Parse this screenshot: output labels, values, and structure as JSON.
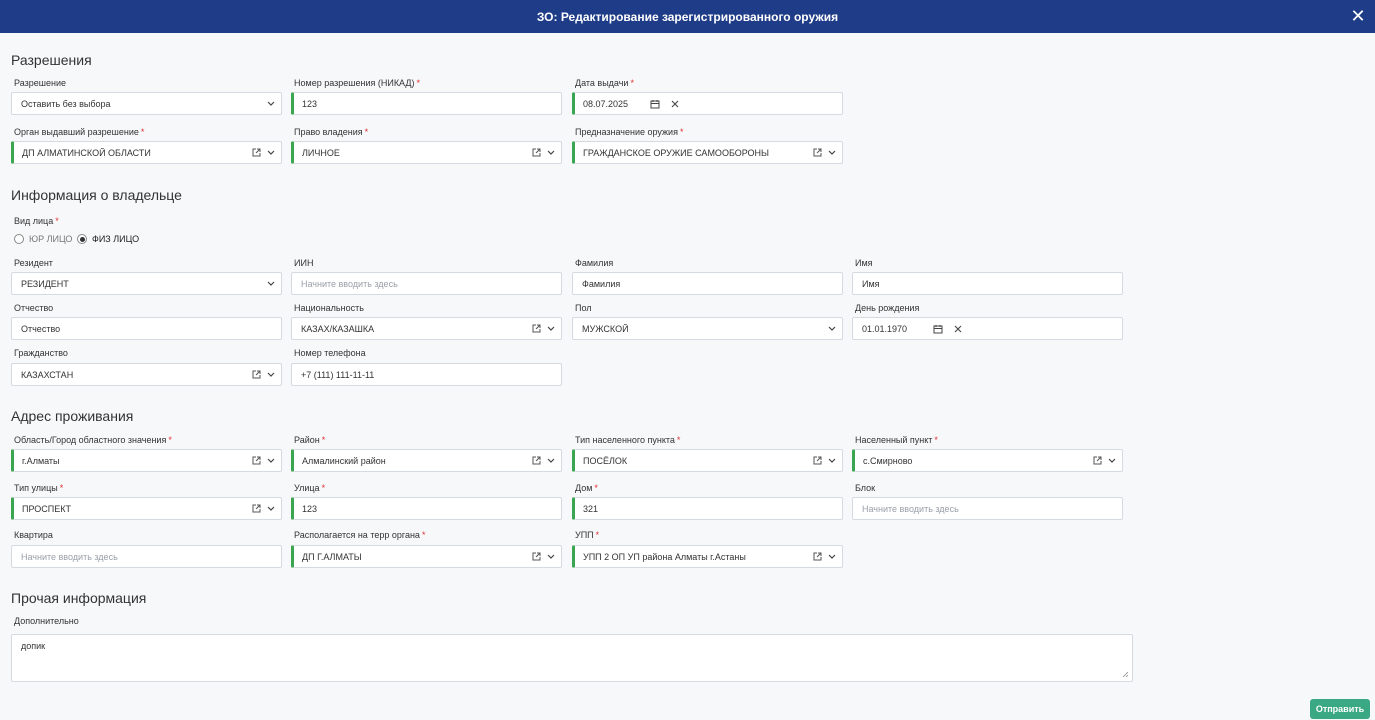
{
  "window": {
    "title": "ЗО: Редактирование зарегистрированного оружия",
    "close_label": "✕"
  },
  "permits": {
    "title": "Разрешения",
    "permit": {
      "label": "Разрешение",
      "value": "Оставить без выбора"
    },
    "permit_number": {
      "label": "Номер разрешения (НИКАД)",
      "value": "123"
    },
    "issue_date": {
      "label": "Дата выдачи",
      "value": "08.07.2025"
    },
    "issuing_body": {
      "label": "Орган выдавший разрешение",
      "value": "ДП АЛМАТИНСКОЙ ОБЛАСТИ"
    },
    "ownership_right": {
      "label": "Право владения",
      "value": "ЛИЧНОЕ"
    },
    "weapon_purpose": {
      "label": "Предназначение оружия",
      "value": "ГРАЖДАНСКОЕ ОРУЖИЕ САМООБОРОНЫ"
    }
  },
  "owner": {
    "title": "Информация о владельце",
    "person_type": {
      "label": "Вид лица",
      "options": [
        "ЮР ЛИЦО",
        "ФИЗ ЛИЦО"
      ],
      "selected": "ФИЗ ЛИЦО"
    },
    "resident": {
      "label": "Резидент",
      "value": "РЕЗИДЕНТ"
    },
    "iin": {
      "label": "ИИН",
      "placeholder": "Начните вводить здесь"
    },
    "last_name": {
      "label": "Фамилия",
      "value": "Фамилия"
    },
    "first_name": {
      "label": "Имя",
      "value": "Имя"
    },
    "patronymic": {
      "label": "Отчество",
      "value": "Отчество"
    },
    "nationality": {
      "label": "Национальность",
      "value": "КАЗАХ/КАЗАШКА"
    },
    "gender": {
      "label": "Пол",
      "value": "МУЖСКОЙ"
    },
    "birthday": {
      "label": "День рождения",
      "value": "01.01.1970"
    },
    "citizenship": {
      "label": "Гражданство",
      "value": "КАЗАХСТАН"
    },
    "phone": {
      "label": "Номер телефона",
      "value": "+7 (111) 111-11-11"
    }
  },
  "address": {
    "title": "Адрес проживания",
    "region": {
      "label": "Область/Город областного значения",
      "value": "г.Алматы"
    },
    "district": {
      "label": "Район",
      "value": "Алмалинский район"
    },
    "locality_type": {
      "label": "Тип населенного пункта",
      "value": "ПОСЁЛОК"
    },
    "locality": {
      "label": "Населенный пункт",
      "value": "с.Смирново"
    },
    "street_type": {
      "label": "Тип улицы",
      "value": "ПРОСПЕКТ"
    },
    "street": {
      "label": "Улица",
      "value": "123"
    },
    "house": {
      "label": "Дом",
      "value": "321"
    },
    "block": {
      "label": "Блок",
      "placeholder": "Начните вводить здесь"
    },
    "apartment": {
      "label": "Квартира",
      "placeholder": "Начните вводить здесь"
    },
    "territory_body": {
      "label": "Располагается на терр органа",
      "value": "ДП Г.АЛМАТЫ"
    },
    "upp": {
      "label": "УПП",
      "value": "УПП 2 ОП УП района Алматы г.Астаны"
    }
  },
  "other": {
    "title": "Прочая информация",
    "additional": {
      "label": "Дополнительно",
      "value": "допик"
    }
  },
  "submit_label": "Отправить",
  "required_mark": "*",
  "colors": {
    "header": "#1f3c88",
    "accent_green": "#3aa652",
    "submit": "#3aa882",
    "required": "#e03030"
  },
  "icons": {
    "calendar": "calendar-icon",
    "clear": "clear-icon",
    "external": "external-link-icon",
    "chevron": "chevron-down-icon"
  }
}
